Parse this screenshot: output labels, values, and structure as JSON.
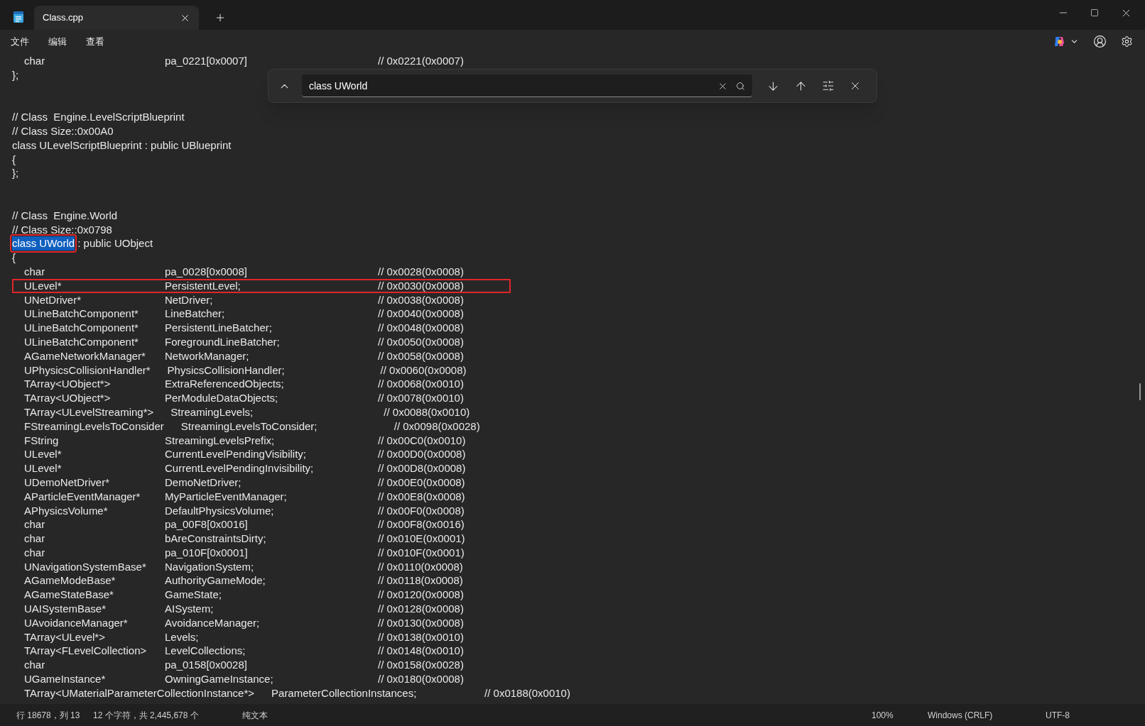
{
  "window": {
    "tab_title": "Class.cpp"
  },
  "menu": [
    "文件",
    "编辑",
    "查看"
  ],
  "find_bar": {
    "query": "class UWorld"
  },
  "lines": [
    {
      "kind": "field",
      "type": "char",
      "name": "pa_0221[0x0007]",
      "comment": "// 0x0221(0x0007)",
      "annotated": false
    },
    {
      "kind": "text",
      "text": "};"
    },
    {
      "kind": "blank"
    },
    {
      "kind": "blank"
    },
    {
      "kind": "text",
      "text": "// Class  Engine.LevelScriptBlueprint"
    },
    {
      "kind": "text",
      "text": "// Class Size::0x00A0"
    },
    {
      "kind": "text",
      "text": "class ULevelScriptBlueprint : public UBlueprint"
    },
    {
      "kind": "text",
      "text": "{"
    },
    {
      "kind": "text",
      "text": "};"
    },
    {
      "kind": "blank"
    },
    {
      "kind": "blank"
    },
    {
      "kind": "text",
      "text": "// Class  Engine.World"
    },
    {
      "kind": "text",
      "text": "// Class Size::0x0798"
    },
    {
      "kind": "segments",
      "segments": [
        {
          "text": "class UWorld",
          "selected": true,
          "annotated": true
        },
        {
          "text": " : public UObject",
          "selected": false,
          "annotated": false
        }
      ]
    },
    {
      "kind": "text",
      "text": "{"
    },
    {
      "kind": "field",
      "type": "char",
      "name": "pa_0028[0x0008]",
      "comment": "// 0x0028(0x0008)",
      "annotated": false
    },
    {
      "kind": "field",
      "type": "ULevel*",
      "name": "PersistentLevel;",
      "comment": "// 0x0030(0x0008)",
      "annotated": true
    },
    {
      "kind": "field",
      "type": "UNetDriver*",
      "name": "NetDriver;",
      "comment": "// 0x0038(0x0008)",
      "annotated": false
    },
    {
      "kind": "field",
      "type": "ULineBatchComponent*",
      "name": "LineBatcher;",
      "comment": "// 0x0040(0x0008)",
      "annotated": false
    },
    {
      "kind": "field",
      "type": "ULineBatchComponent*",
      "name": "PersistentLineBatcher;",
      "comment": "// 0x0048(0x0008)",
      "annotated": false
    },
    {
      "kind": "field",
      "type": "ULineBatchComponent*",
      "name": "ForegroundLineBatcher;",
      "comment": "// 0x0050(0x0008)",
      "annotated": false
    },
    {
      "kind": "field",
      "type": "AGameNetworkManager*",
      "name": "NetworkManager;",
      "comment": "// 0x0058(0x0008)",
      "annotated": false
    },
    {
      "kind": "field",
      "type": "UPhysicsCollisionHandler*",
      "name": "PhysicsCollisionHandler;",
      "comment": "// 0x0060(0x0008)",
      "annotated": false
    },
    {
      "kind": "field",
      "type": "TArray<UObject*>",
      "name": "ExtraReferencedObjects;",
      "comment": "// 0x0068(0x0010)",
      "annotated": false
    },
    {
      "kind": "field",
      "type": "TArray<UObject*>",
      "name": "PerModuleDataObjects;",
      "comment": "// 0x0078(0x0010)",
      "annotated": false
    },
    {
      "kind": "field",
      "type": "TArray<ULevelStreaming*>",
      "name": "StreamingLevels;",
      "comment": "// 0x0088(0x0010)",
      "annotated": false
    },
    {
      "kind": "field",
      "type": "FStreamingLevelsToConsider",
      "name": "StreamingLevelsToConsider;",
      "comment": "// 0x0098(0x0028)",
      "annotated": false
    },
    {
      "kind": "field",
      "type": "FString",
      "name": "StreamingLevelsPrefix;",
      "comment": "// 0x00C0(0x0010)",
      "annotated": false
    },
    {
      "kind": "field",
      "type": "ULevel*",
      "name": "CurrentLevelPendingVisibility;",
      "comment": "// 0x00D0(0x0008)",
      "annotated": false
    },
    {
      "kind": "field",
      "type": "ULevel*",
      "name": "CurrentLevelPendingInvisibility;",
      "comment": "// 0x00D8(0x0008)",
      "annotated": false
    },
    {
      "kind": "field",
      "type": "UDemoNetDriver*",
      "name": "DemoNetDriver;",
      "comment": "// 0x00E0(0x0008)",
      "annotated": false
    },
    {
      "kind": "field",
      "type": "AParticleEventManager*",
      "name": "MyParticleEventManager;",
      "comment": "// 0x00E8(0x0008)",
      "annotated": false
    },
    {
      "kind": "field",
      "type": "APhysicsVolume*",
      "name": "DefaultPhysicsVolume;",
      "comment": "// 0x00F0(0x0008)",
      "annotated": false
    },
    {
      "kind": "field",
      "type": "char",
      "name": "pa_00F8[0x0016]",
      "comment": "// 0x00F8(0x0016)",
      "annotated": false
    },
    {
      "kind": "field",
      "type": "char",
      "name": "bAreConstraintsDirty;",
      "comment": "// 0x010E(0x0001)",
      "annotated": false
    },
    {
      "kind": "field",
      "type": "char",
      "name": "pa_010F[0x0001]",
      "comment": "// 0x010F(0x0001)",
      "annotated": false
    },
    {
      "kind": "field",
      "type": "UNavigationSystemBase*",
      "name": "NavigationSystem;",
      "comment": "// 0x0110(0x0008)",
      "annotated": false
    },
    {
      "kind": "field",
      "type": "AGameModeBase*",
      "name": "AuthorityGameMode;",
      "comment": "// 0x0118(0x0008)",
      "annotated": false
    },
    {
      "kind": "field",
      "type": "AGameStateBase*",
      "name": "GameState;",
      "comment": "// 0x0120(0x0008)",
      "annotated": false
    },
    {
      "kind": "field",
      "type": "UAISystemBase*",
      "name": "AISystem;",
      "comment": "// 0x0128(0x0008)",
      "annotated": false
    },
    {
      "kind": "field",
      "type": "UAvoidanceManager*",
      "name": "AvoidanceManager;",
      "comment": "// 0x0130(0x0008)",
      "annotated": false
    },
    {
      "kind": "field",
      "type": "TArray<ULevel*>",
      "name": "Levels;",
      "comment": "// 0x0138(0x0010)",
      "annotated": false
    },
    {
      "kind": "field",
      "type": "TArray<FLevelCollection>",
      "name": "LevelCollections;",
      "comment": "// 0x0148(0x0010)",
      "annotated": false
    },
    {
      "kind": "field",
      "type": "char",
      "name": "pa_0158[0x0028]",
      "comment": "// 0x0158(0x0028)",
      "annotated": false
    },
    {
      "kind": "field",
      "type": "UGameInstance*",
      "name": "OwningGameInstance;",
      "comment": "// 0x0180(0x0008)",
      "annotated": false
    },
    {
      "kind": "field",
      "type": "TArray<UMaterialParameterCollectionInstance*>",
      "name": "ParameterCollectionInstances;",
      "comment": "// 0x0188(0x0010)",
      "annotated": false
    }
  ],
  "status_bar": {
    "position": "行 18678，列 13",
    "selection": "12 个字符，共 2,445,678 个",
    "format": "纯文本",
    "zoom": "100%",
    "line_ending": "Windows (CRLF)",
    "encoding": "UTF-8"
  }
}
